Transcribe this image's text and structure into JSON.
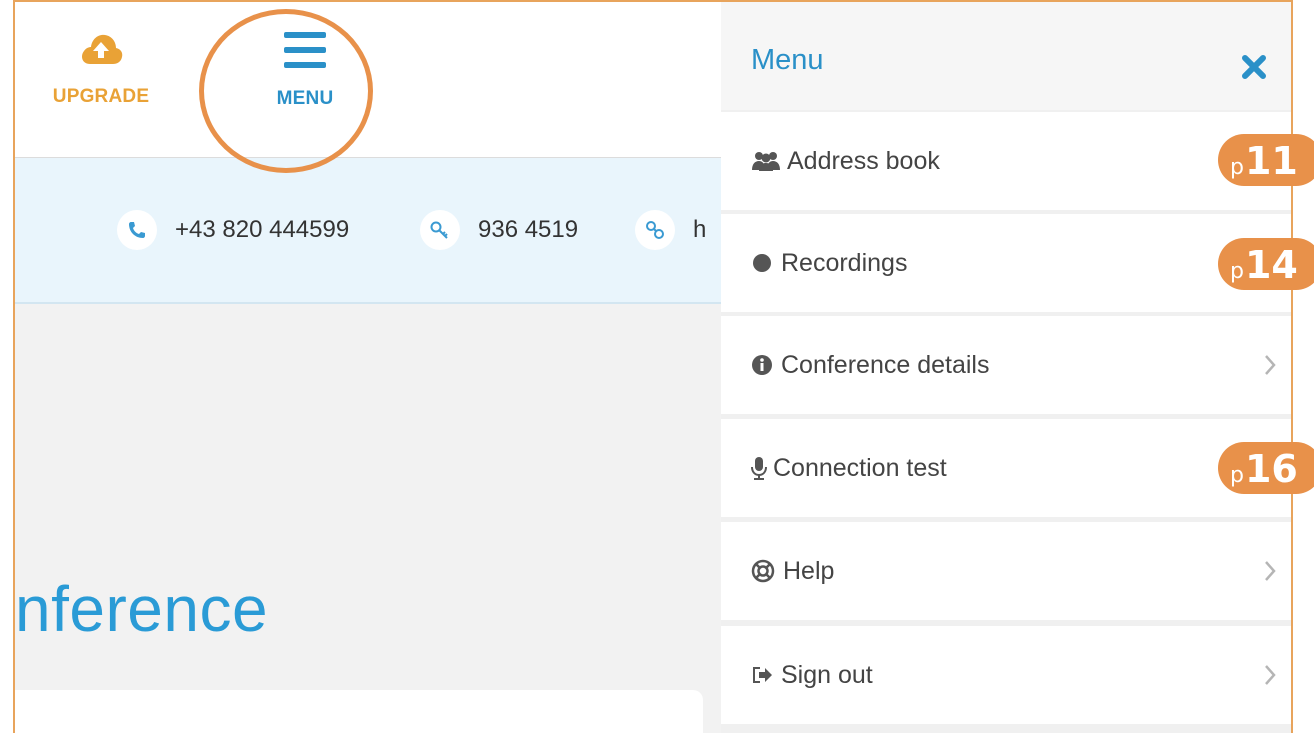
{
  "topbar": {
    "upgrade_label": "UPGRADE",
    "menu_label": "MENU"
  },
  "infobar": {
    "phone": "+43 820 444599",
    "pin": "936 4519",
    "link": "h"
  },
  "main": {
    "heading": "nference"
  },
  "menu": {
    "title": "Menu",
    "items": [
      {
        "label": "Address book",
        "icon": "users-icon",
        "badge": {
          "prefix": "p",
          "number": "11"
        }
      },
      {
        "label": "Recordings",
        "icon": "record-dot-icon",
        "badge": {
          "prefix": "p",
          "number": "14"
        }
      },
      {
        "label": "Conference details",
        "icon": "info-icon"
      },
      {
        "label": "Connection test",
        "icon": "microphone-icon",
        "badge": {
          "prefix": "p",
          "number": "16"
        }
      },
      {
        "label": "Help",
        "icon": "lifebuoy-icon"
      },
      {
        "label": "Sign out",
        "icon": "sign-out-icon"
      }
    ]
  },
  "colors": {
    "accent_blue": "#2a90c8",
    "upgrade_orange": "#e9a236",
    "annotation_orange": "#e8914a",
    "info_bar_bg": "#e9f5fc"
  }
}
